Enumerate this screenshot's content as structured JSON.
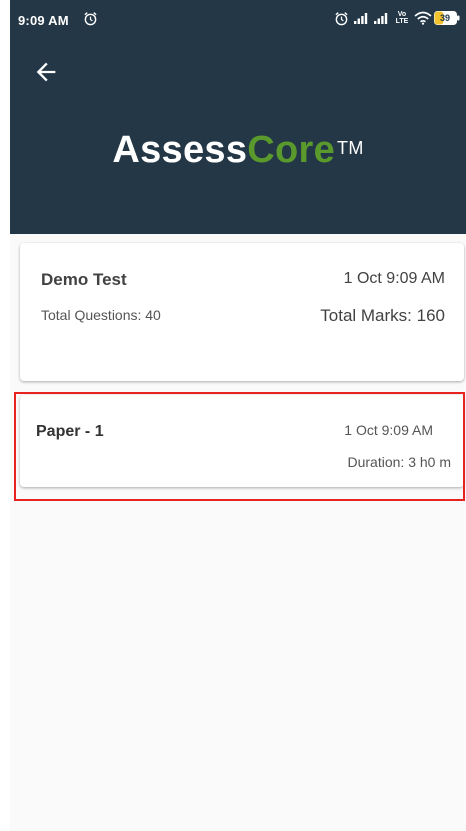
{
  "status_bar": {
    "time": "9:09 AM",
    "network_label": "Vo\nLTE",
    "battery": "39"
  },
  "header": {
    "brand_part1": "Assess",
    "brand_part2": "Core",
    "brand_tm": "TM"
  },
  "test_card": {
    "name": "Demo Test",
    "date": "1 Oct 9:09 AM",
    "total_questions": "Total Questions: 40",
    "total_marks": "Total Marks: 160"
  },
  "paper_card": {
    "name": "Paper - 1",
    "date": "1 Oct 9:09 AM",
    "duration": "Duration: 3 h0 m"
  },
  "colors": {
    "header_bg": "#233746",
    "brand_green": "#5a9a2c",
    "highlight": "#e8231f"
  },
  "icons": [
    "alarm-icon",
    "signal-icon",
    "wifi-icon",
    "battery-icon",
    "back-arrow-icon"
  ]
}
